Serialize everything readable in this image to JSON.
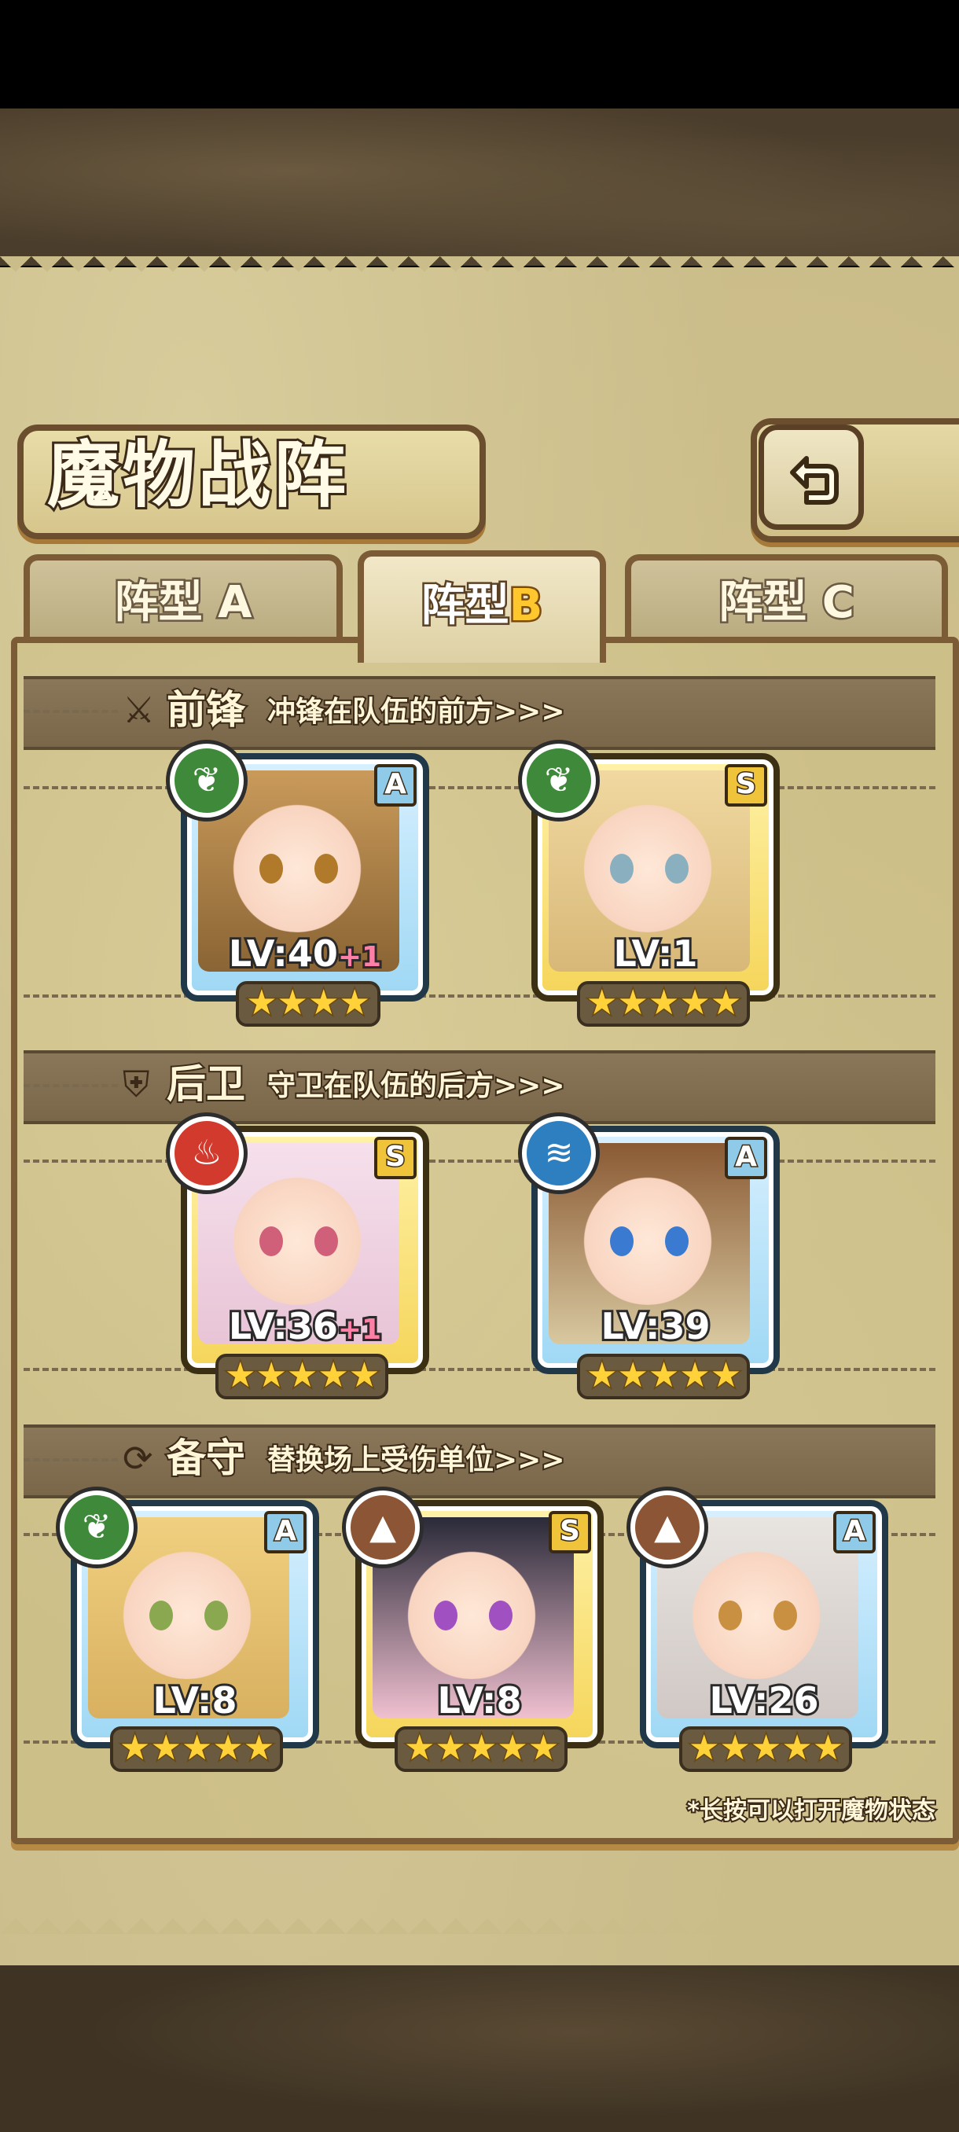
{
  "title": "魔物战阵",
  "tabs": [
    {
      "prefix": "阵型",
      "letter": "A"
    },
    {
      "prefix": "阵型",
      "letter": "B"
    },
    {
      "prefix": "阵型",
      "letter": "C"
    }
  ],
  "active_tab": "B",
  "sections": {
    "front": {
      "title": "前锋",
      "subtitle": "冲锋在队伍的前方>>>",
      "icon": "sword-icon"
    },
    "back": {
      "title": "后卫",
      "subtitle": "守卫在队伍的后方>>>",
      "icon": "shield-icon"
    },
    "reserve": {
      "title": "备守",
      "subtitle": "替换场上受伤单位>>>",
      "icon": "refresh-icon"
    }
  },
  "units": {
    "front1": {
      "level": "LV:40",
      "bonus": "+1",
      "rank": "A",
      "element": "grass-icon",
      "stars": "★★★★"
    },
    "front2": {
      "level": "LV:1",
      "bonus": "",
      "rank": "S",
      "element": "grass-icon",
      "stars": "★★★★★"
    },
    "back1": {
      "level": "LV:36",
      "bonus": "+1",
      "rank": "S",
      "element": "fire-icon",
      "stars": "★★★★★"
    },
    "back2": {
      "level": "LV:39",
      "bonus": "",
      "rank": "A",
      "element": "water-icon",
      "stars": "★★★★★"
    },
    "res1": {
      "level": "LV:8",
      "bonus": "",
      "rank": "A",
      "element": "grass-icon",
      "stars": "★★★★★"
    },
    "res2": {
      "level": "LV:8",
      "bonus": "",
      "rank": "S",
      "element": "earth-icon",
      "stars": "★★★★★"
    },
    "res3": {
      "level": "LV:26",
      "bonus": "",
      "rank": "A",
      "element": "earth-icon",
      "stars": "★★★★★"
    }
  },
  "footnote": "*长按可以打开魔物状态",
  "colors": {
    "grass": "#3f8a3a",
    "fire": "#d23a2e",
    "water": "#2e7fc0",
    "earth": "#8c5636",
    "rank_s": "#f0c43a",
    "rank_a": "#8fcbe8"
  }
}
